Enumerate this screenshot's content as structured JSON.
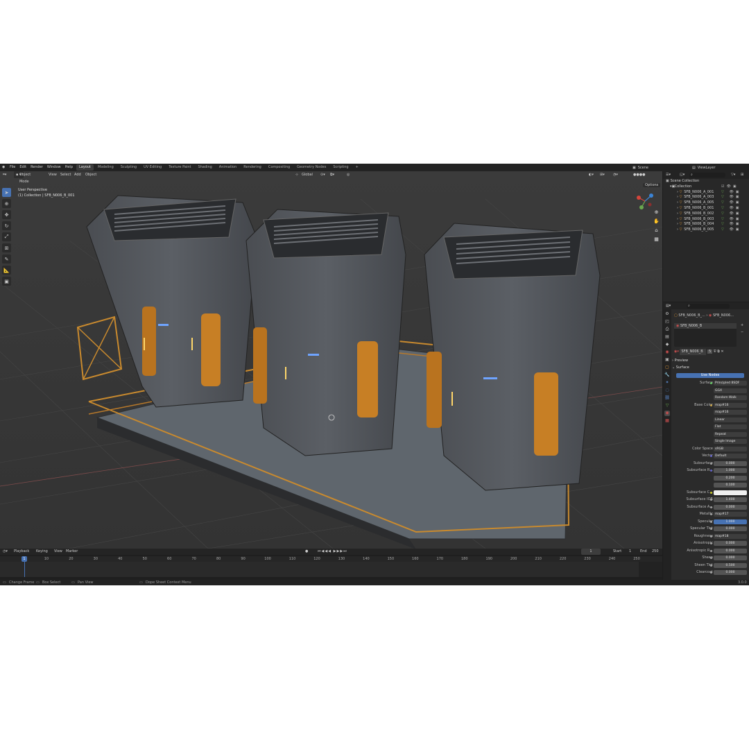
{
  "topbar": {
    "menus": [
      "File",
      "Edit",
      "Render",
      "Window",
      "Help"
    ],
    "workspaces": [
      "Layout",
      "Modeling",
      "Sculpting",
      "UV Editing",
      "Texture Paint",
      "Shading",
      "Animation",
      "Rendering",
      "Compositing",
      "Geometry Nodes",
      "Scripting",
      "+"
    ],
    "active_workspace": "Layout",
    "scene_label": "Scene",
    "view_layer_label": "ViewLayer"
  },
  "viewport": {
    "mode": "Object Mode",
    "menus": [
      "View",
      "Select",
      "Add",
      "Object"
    ],
    "transform_orientation": "Global",
    "options_label": "Options",
    "perspective_label": "User Perspective",
    "collection_label": "(1) Collection | SFB_N006_B_001"
  },
  "outliner": {
    "root": "Scene Collection",
    "collection": "Collection",
    "items": [
      "SFB_N006_A_001",
      "SFB_N006_A_003",
      "SFB_N006_A_005",
      "SFB_N006_B_001",
      "SFB_N006_B_002",
      "SFB_N006_B_003",
      "SFB_N006_B_004",
      "SFB_N006_B_005"
    ]
  },
  "properties": {
    "breadcrumb_object": "SFB_N006_B_...",
    "breadcrumb_material": "SFB_N006...",
    "material_slot": "SFB_N006_B",
    "material_name": "SFB_N006_B",
    "material_users": "5",
    "sections": {
      "preview": "Preview",
      "surface": "Surface"
    },
    "use_nodes_label": "Use Nodes",
    "rows": [
      {
        "label": "Surface",
        "value": "Principled BSDF",
        "style": "dark",
        "dot": "#63c763"
      },
      {
        "label": "",
        "value": "GGX",
        "style": "dark"
      },
      {
        "label": "",
        "value": "Random Walk",
        "style": "dark"
      },
      {
        "label": "Base Color",
        "value": "map#16",
        "style": "dark",
        "dot": "#c7a24a"
      },
      {
        "label": "",
        "value": "map#16",
        "style": "dark"
      },
      {
        "label": "",
        "value": "Linear",
        "style": "dark"
      },
      {
        "label": "",
        "value": "Flat",
        "style": "dark"
      },
      {
        "label": "",
        "value": "Repeat",
        "style": "dark"
      },
      {
        "label": "",
        "value": "Single Image",
        "style": "dark"
      },
      {
        "label": "Color Space",
        "value": "sRGB",
        "style": "dark"
      },
      {
        "label": "Vector",
        "value": "Default",
        "style": "dark",
        "dot": "#6363c7"
      },
      {
        "label": "Subsurface",
        "value": "0.000",
        "style": "grey",
        "dot": "#a1a1a1"
      },
      {
        "label": "Subsurface R...",
        "value": "1.000",
        "style": "grey",
        "dot": "#6363c7"
      },
      {
        "label": "",
        "value": "0.200",
        "style": "grey"
      },
      {
        "label": "",
        "value": "0.100",
        "style": "grey"
      },
      {
        "label": "Subsurface C...",
        "value": "",
        "style": "white",
        "dot": "#c7c729"
      },
      {
        "label": "Subsurface IOR",
        "value": "1.400",
        "style": "grey",
        "dot": "#a1a1a1"
      },
      {
        "label": "Subsurface A...",
        "value": "0.000",
        "style": "grey",
        "dot": "#a1a1a1"
      },
      {
        "label": "Metallic",
        "value": "map#17",
        "style": "dark",
        "dot": "#a1a1a1"
      },
      {
        "label": "Specular",
        "value": "1.000",
        "style": "blue",
        "dot": "#a1a1a1"
      },
      {
        "label": "Specular Tint",
        "value": "0.000",
        "style": "grey",
        "dot": "#a1a1a1"
      },
      {
        "label": "Roughness",
        "value": "map#18",
        "style": "dark",
        "dot": "#a1a1a1"
      },
      {
        "label": "Anisotropic",
        "value": "0.000",
        "style": "grey",
        "dot": "#a1a1a1"
      },
      {
        "label": "Anisotropic R...",
        "value": "0.000",
        "style": "grey",
        "dot": "#a1a1a1"
      },
      {
        "label": "Sheen",
        "value": "0.000",
        "style": "grey",
        "dot": "#a1a1a1"
      },
      {
        "label": "Sheen Tint",
        "value": "0.500",
        "style": "grey",
        "dot": "#a1a1a1"
      },
      {
        "label": "Clearcoat",
        "value": "0.000",
        "style": "grey",
        "dot": "#a1a1a1"
      }
    ]
  },
  "timeline": {
    "menus": [
      "Playback",
      "Keying",
      "View",
      "Marker"
    ],
    "current_frame": "1",
    "start_label": "Start",
    "start": "1",
    "end_label": "End",
    "end": "250",
    "ticks": [
      "1",
      "10",
      "20",
      "30",
      "40",
      "50",
      "60",
      "70",
      "80",
      "90",
      "100",
      "110",
      "120",
      "130",
      "140",
      "150",
      "160",
      "170",
      "180",
      "190",
      "200",
      "210",
      "220",
      "230",
      "240",
      "250"
    ]
  },
  "statusbar": {
    "items": [
      "Change Frame",
      "Box Select",
      "Pan View",
      "Dope Sheet Context Menu"
    ],
    "version": "3.0.0"
  },
  "colors": {
    "accent": "#4772b3",
    "orange": "#e09838",
    "background": "#1d1d1d",
    "viewport": "#3a3a3a"
  }
}
